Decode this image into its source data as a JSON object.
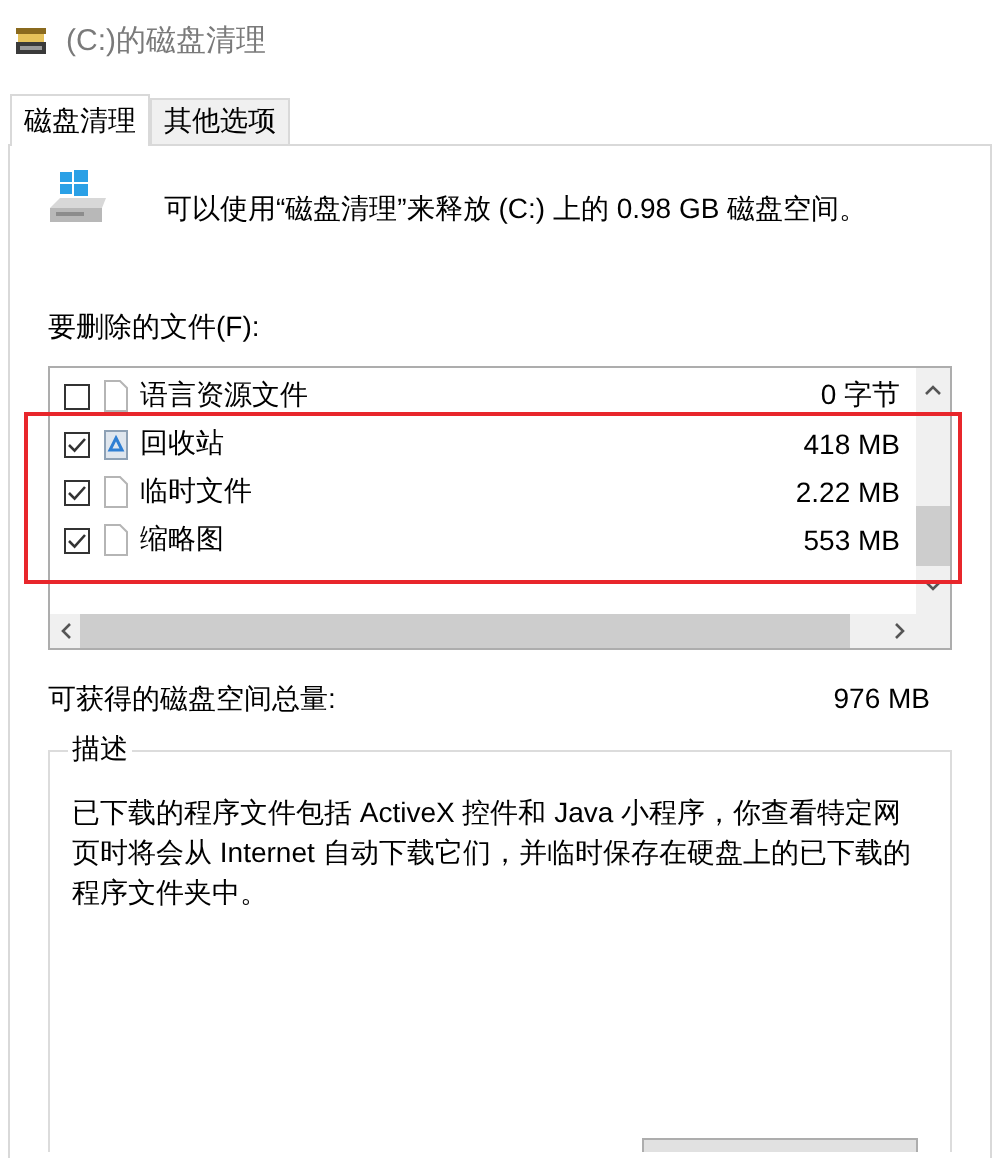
{
  "window": {
    "title": "(C:)的磁盘清理"
  },
  "tabs": [
    {
      "label": "磁盘清理",
      "selected": true
    },
    {
      "label": "其他选项",
      "selected": false
    }
  ],
  "intro": "可以使用“磁盘清理”来释放 (C:) 上的 0.98 GB 磁盘空间。",
  "files_label": "要删除的文件(F):",
  "files": [
    {
      "name": "语言资源文件",
      "size": "0 字节",
      "checked": false,
      "kind": "file"
    },
    {
      "name": "回收站",
      "size": "418 MB",
      "checked": true,
      "kind": "recycle"
    },
    {
      "name": "临时文件",
      "size": "2.22 MB",
      "checked": true,
      "kind": "file"
    },
    {
      "name": "缩略图",
      "size": "553 MB",
      "checked": true,
      "kind": "file"
    }
  ],
  "total": {
    "label": "可获得的磁盘空间总量:",
    "value": "976 MB"
  },
  "description": {
    "title": "描述",
    "text": "已下载的程序文件包括 ActiveX 控件和 Java 小程序，你查看特定网页时将会从 Internet 自动下载它们，并临时保存在硬盘上的已下载的程序文件夹中。"
  }
}
